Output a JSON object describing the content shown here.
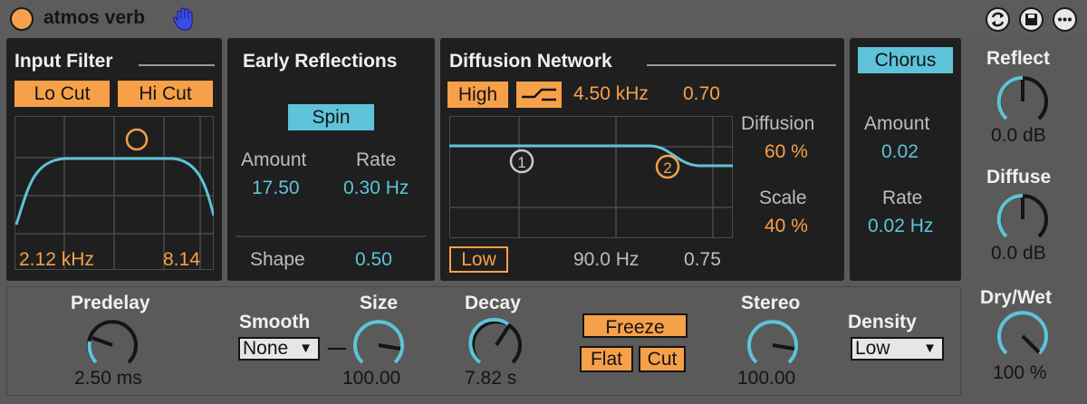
{
  "header": {
    "title": "atmos verb"
  },
  "input_filter": {
    "title": "Input Filter",
    "lo_cut": "Lo Cut",
    "hi_cut": "Hi Cut",
    "low_value": "2.12 kHz",
    "high_value": "8.14"
  },
  "early_reflections": {
    "title": "Early Reflections",
    "spin": "Spin",
    "amount_label": "Amount",
    "amount_value": "17.50",
    "rate_label": "Rate",
    "rate_value": "0.30 Hz",
    "shape_label": "Shape",
    "shape_value": "0.50"
  },
  "diffusion_network": {
    "title": "Diffusion Network",
    "high_label": "High",
    "high_freq": "4.50 kHz",
    "high_q": "0.70",
    "low_label": "Low",
    "low_freq": "90.0 Hz",
    "low_q": "0.75",
    "diffusion_label": "Diffusion",
    "diffusion_value": "60 %",
    "scale_label": "Scale",
    "scale_value": "40 %",
    "point1": "1",
    "point2": "2"
  },
  "chorus": {
    "title": "Chorus",
    "amount_label": "Amount",
    "amount_value": "0.02",
    "rate_label": "Rate",
    "rate_value": "0.02 Hz"
  },
  "right": {
    "reflect_label": "Reflect",
    "reflect_value": "0.0 dB",
    "diffuse_label": "Diffuse",
    "diffuse_value": "0.0 dB",
    "drywet_label": "Dry/Wet",
    "drywet_value": "100 %"
  },
  "bottom": {
    "predelay_label": "Predelay",
    "predelay_value": "2.50 ms",
    "smooth_label": "Smooth",
    "smooth_value": "None",
    "size_label": "Size",
    "size_value": "100.00",
    "decay_label": "Decay",
    "decay_value": "7.82 s",
    "freeze": "Freeze",
    "flat": "Flat",
    "cut": "Cut",
    "stereo_label": "Stereo",
    "stereo_value": "100.00",
    "density_label": "Density",
    "density_value": "Low"
  },
  "colors": {
    "accent_orange": "#f7a04a",
    "accent_blue": "#5ec3d8",
    "panel": "#1f1f1f"
  },
  "icons": [
    "power-icon",
    "hand-icon",
    "hotswap-icon",
    "save-icon",
    "more-icon",
    "dropdown-arrow-icon"
  ]
}
